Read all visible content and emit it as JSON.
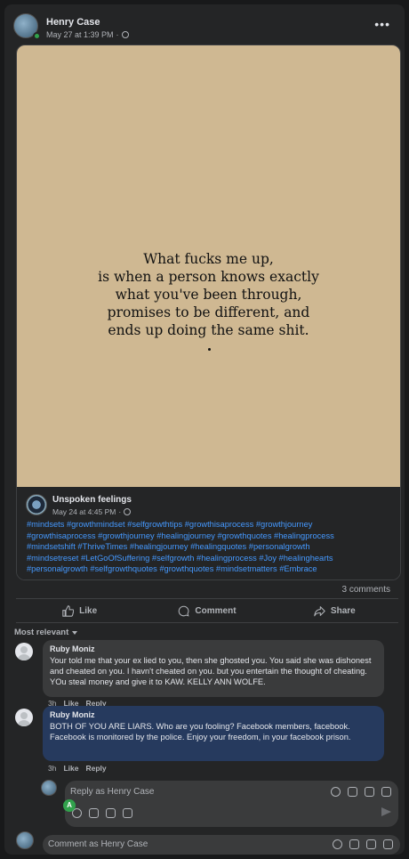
{
  "post": {
    "author": "Henry Case",
    "timestamp": "May 27 at 1:39 PM",
    "audience_icon": "globe-icon",
    "more_icon": "•••"
  },
  "shared_post": {
    "quote_lines": [
      "What fucks me up,",
      "is when a person knows exactly",
      "what you've been through,",
      "promises to be different, and",
      "ends up doing the same shit."
    ],
    "page_name": "Unspoken feelings",
    "timestamp": "May 24 at 4:45 PM",
    "hashtags": [
      "#mindsets #growthmindset #selfgrowthtips #growthisaprocess #growthjourney",
      "#growthisaprocess #growthjourney #healingjourney #growthquotes #healingprocess",
      "#mindsetshift #ThriveTimes #healingjourney #healingquotes #personalgrowth",
      "#mindsetreset #LetGoOfSuffering #selfgrowth #healingprocess #Joy #healinghearts",
      "#personalgrowth #selfgrowthquotes #growthquotes #mindsetmatters #Embrace"
    ]
  },
  "stats": {
    "comments": "3 comments"
  },
  "actions": {
    "like": "Like",
    "comment": "Comment",
    "share": "Share"
  },
  "sort": {
    "label": "Most relevant"
  },
  "comments": [
    {
      "name": "Ruby Moniz",
      "text": "Your told me that your ex lied to you, then she ghosted you. You said she was dishonest and cheated on you. I havn't cheated on you. but you entertain the thought of cheating. YOu steal money and give it to KAW. KELLY ANN WOLFE.",
      "time": "3h",
      "like": "Like",
      "reply": "Reply"
    },
    {
      "name": "Ruby Moniz",
      "text": "BOTH OF YOU ARE LIARS. Who are you fooling? Facebook members, facebook. Facebook is monitored by the police. Enjoy your freedom, in your facebook prison.",
      "time": "3h",
      "like": "Like",
      "reply": "Reply"
    }
  ],
  "reply_box": {
    "placeholder": "Reply as Henry Case",
    "badge": "A"
  },
  "comment_box": {
    "placeholder": "Comment as Henry Case"
  },
  "colors": {
    "link": "#4599ff",
    "highlight_bubble": "#263a5e",
    "bubble": "#3a3b3c",
    "quote_bg": "#cfb892",
    "online": "#31a24c"
  }
}
